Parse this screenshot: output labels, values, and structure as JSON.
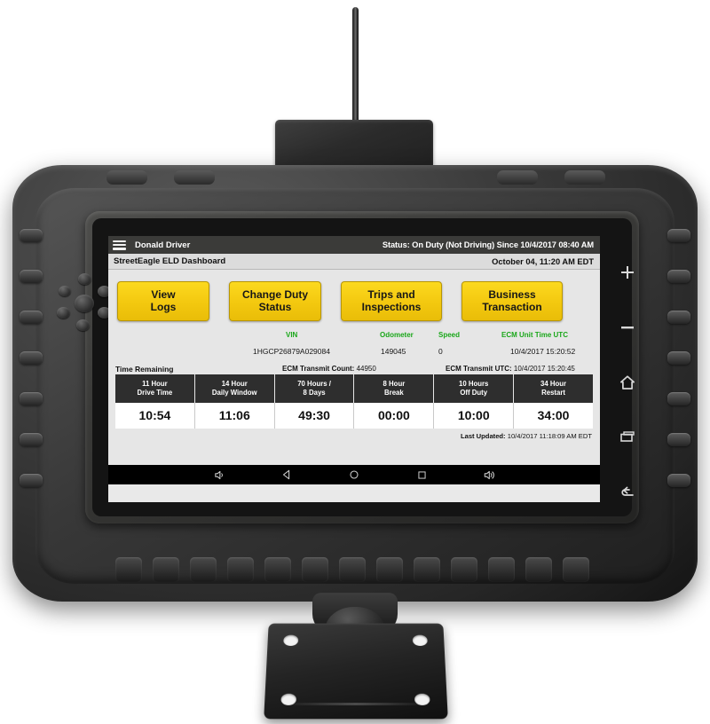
{
  "device": {
    "name": "rugged-tablet-eld",
    "antenna": "antenna-rod",
    "hardware_buttons": [
      {
        "name": "volume-up-button",
        "icon": "plus-icon",
        "label": "+"
      },
      {
        "name": "volume-down-button",
        "icon": "minus-icon",
        "label": "−"
      },
      {
        "name": "home-button",
        "icon": "home-icon",
        "label": "Home"
      },
      {
        "name": "recents-button",
        "icon": "recents-icon",
        "label": "Recent Apps"
      },
      {
        "name": "back-button",
        "icon": "back-icon",
        "label": "Back"
      }
    ]
  },
  "screen": {
    "statusbar": {
      "menu_icon": "hamburger-menu-icon",
      "user": "Donald Driver",
      "status": "Status: On Duty (Not Driving) Since 10/4/2017 08:40 AM"
    },
    "titlebar": {
      "title": "StreetEagle ELD Dashboard",
      "datetime": "October 04, 11:20 AM EDT"
    },
    "action_buttons": [
      {
        "name": "view-logs-button",
        "line1": "View",
        "line2": "Logs"
      },
      {
        "name": "change-duty-status-button",
        "line1": "Change Duty",
        "line2": "Status"
      },
      {
        "name": "trips-and-inspections-button",
        "line1": "Trips and",
        "line2": "Inspections"
      },
      {
        "name": "business-transaction-button",
        "line1": "Business",
        "line2": "Transaction"
      }
    ],
    "vehicle_info": {
      "headers": {
        "vin": "VIN",
        "odometer": "Odometer",
        "speed": "Speed",
        "ecm_unit_time": "ECM Unit Time UTC"
      },
      "values": {
        "vin": "1HGCP26879A029084",
        "odometer": "149045",
        "speed": "0",
        "ecm_unit_time": "10/4/2017 15:20:52"
      },
      "ecm_transmit_count_label": "ECM Transmit Count:",
      "ecm_transmit_count_value": "44950",
      "ecm_transmit_utc_label": "ECM Transmit UTC:",
      "ecm_transmit_utc_value": "10/4/2017 15:20:45"
    },
    "time_remaining_label": "Time Remaining",
    "time_remaining_table": {
      "columns": [
        {
          "line1": "11 Hour",
          "line2": "Drive Time"
        },
        {
          "line1": "14 Hour",
          "line2": "Daily Window"
        },
        {
          "line1": "70 Hours /",
          "line2": "8 Days"
        },
        {
          "line1": "8 Hour",
          "line2": "Break"
        },
        {
          "line1": "10 Hours",
          "line2": "Off Duty"
        },
        {
          "line1": "34 Hour",
          "line2": "Restart"
        }
      ],
      "values": [
        "10:54",
        "11:06",
        "49:30",
        "00:00",
        "10:00",
        "34:00"
      ]
    },
    "last_updated_label": "Last Updated:",
    "last_updated_value": "10/4/2017 11:18:09 AM EDT",
    "navbar": [
      {
        "name": "nav-volume-down-button",
        "icon": "volume-low-icon"
      },
      {
        "name": "nav-back-button",
        "icon": "triangle-back-icon"
      },
      {
        "name": "nav-home-button",
        "icon": "circle-home-icon"
      },
      {
        "name": "nav-recents-button",
        "icon": "square-recents-icon"
      },
      {
        "name": "nav-volume-up-button",
        "icon": "volume-high-icon"
      }
    ]
  },
  "colors": {
    "accent_yellow": "#f3c80f",
    "header_green": "#1aa71a",
    "statusbar_bg": "#3b3b39",
    "table_header_bg": "#2e2e2e",
    "screen_bg": "#e6e6e6"
  }
}
